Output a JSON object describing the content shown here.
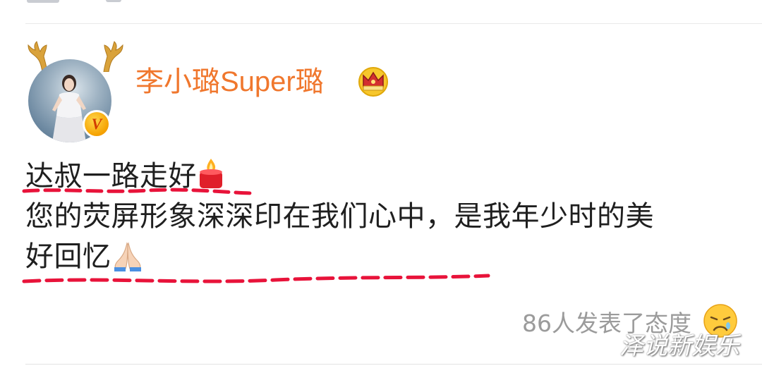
{
  "post": {
    "username": "李小璐Super璐",
    "lines": [
      "达叔一路走好",
      "您的荧屏形象深深印在我们心中，是我年少时的美",
      "好回忆"
    ],
    "reactions_text": "86人发表了态度"
  },
  "icons": {
    "avatar": "avatar-photo",
    "verified_badge": "verified-v-badge",
    "member_crown": "crown-icon",
    "candle": "candle-emoji",
    "pray": "folded-hands-emoji",
    "reaction": "sad-face-emoji"
  },
  "colors": {
    "username": "#f0772d",
    "underline": "#e8133a",
    "reactions_text": "#9b9b9b"
  },
  "watermark": "泽说新娱乐",
  "verified_badge_letter": "V"
}
